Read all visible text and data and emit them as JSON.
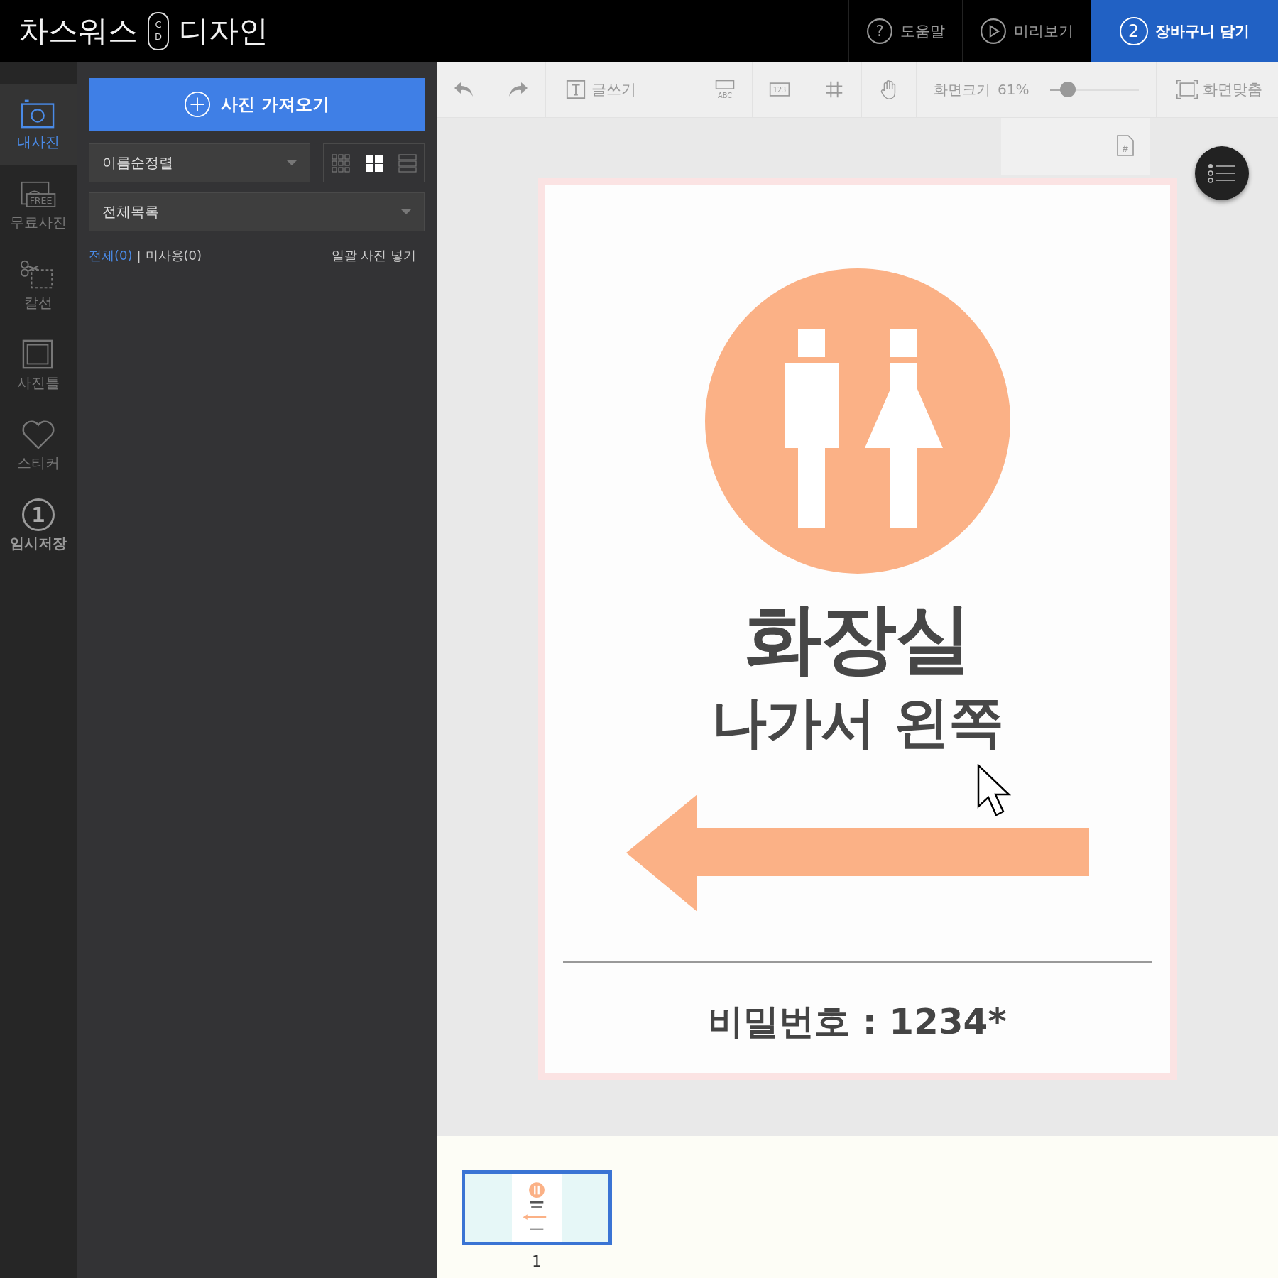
{
  "header": {
    "brand_left": "차스워스",
    "brand_mark": [
      "C",
      "D"
    ],
    "brand_right": "디자인",
    "buttons": [
      {
        "kind": "help",
        "label": "도움말",
        "icon_text": "?",
        "primary": false
      },
      {
        "kind": "preview",
        "label": "미리보기",
        "primary": false
      },
      {
        "kind": "cart",
        "label": "장바구니 담기",
        "badge": "2",
        "primary": true
      }
    ]
  },
  "rail": [
    {
      "kind": "camera",
      "label": "내사진",
      "selected": true
    },
    {
      "kind": "free",
      "label": "무료사진",
      "icon_text": "FREE",
      "selected": false
    },
    {
      "kind": "scissors",
      "label": "칼선",
      "selected": false
    },
    {
      "kind": "frame",
      "label": "사진틀",
      "selected": false
    },
    {
      "kind": "heart",
      "label": "스티커",
      "selected": false
    },
    {
      "kind": "number",
      "label": "임시저장",
      "icon_text": "1",
      "selected": false
    }
  ],
  "panel": {
    "import_button": "사진 가져오기",
    "sort_select": "이름순정렬",
    "view_modes": [
      {
        "kind": "small",
        "selected": false
      },
      {
        "kind": "medium",
        "selected": true
      },
      {
        "kind": "list",
        "selected": false
      }
    ],
    "filter_select": "전체목록",
    "filters": [
      {
        "label": "전체(0)",
        "selected": true
      },
      {
        "label": "미사용(0)",
        "selected": false
      }
    ],
    "filter_separator": "|",
    "bulk_insert": "일괄 사진 넣기"
  },
  "toolbar": {
    "tools": [
      {
        "kind": "undo"
      },
      {
        "kind": "redo"
      },
      {
        "kind": "text",
        "label": "글쓰기"
      },
      {
        "kind": "abc",
        "icon_text": "ABC"
      },
      {
        "kind": "number",
        "icon_text": "123"
      },
      {
        "kind": "grid"
      },
      {
        "kind": "hand"
      }
    ],
    "zoom": {
      "label": "화면크기",
      "value": "61%",
      "level": 0.2
    },
    "fit": "화면맞춤",
    "page_number_icon": "#"
  },
  "canvas": {
    "title": "화장실",
    "subtitle": "나가서 왼쪽",
    "password": "비밀번호 : 1234*"
  },
  "pages": [
    {
      "number": "1",
      "selected": true
    }
  ]
}
